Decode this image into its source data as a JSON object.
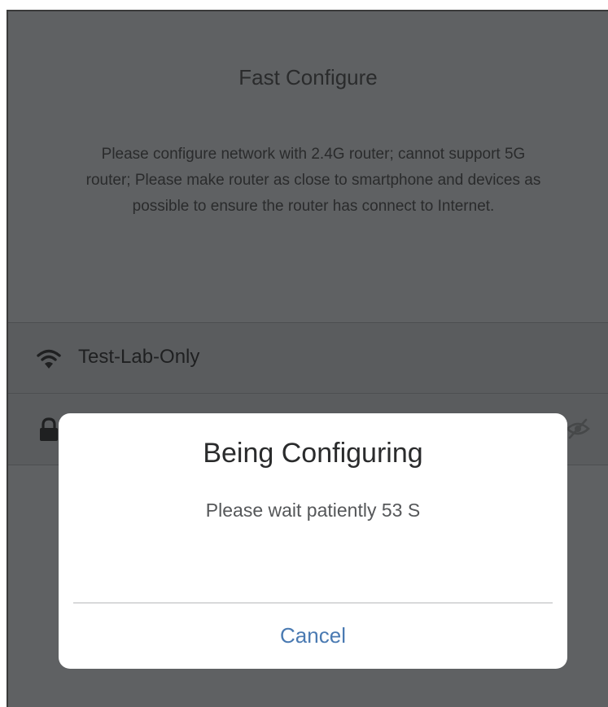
{
  "page": {
    "title": "Fast Configure",
    "description": "Please configure network with 2.4G router; cannot support 5G router; Please make router as close to smartphone and devices as possible to ensure the router has connect to Internet."
  },
  "network": {
    "ssid": "Test-Lab-Only",
    "ssid_icon": "wifi-icon",
    "password_icon": "lock-icon",
    "visibility_icon": "eye-icon"
  },
  "dialog": {
    "title": "Being Configuring",
    "message": "Please wait patiently 53 S",
    "cancel_label": "Cancel"
  },
  "colors": {
    "overlay_background": "#5f6163",
    "dialog_background": "#ffffff",
    "accent": "#4a7ab2"
  }
}
